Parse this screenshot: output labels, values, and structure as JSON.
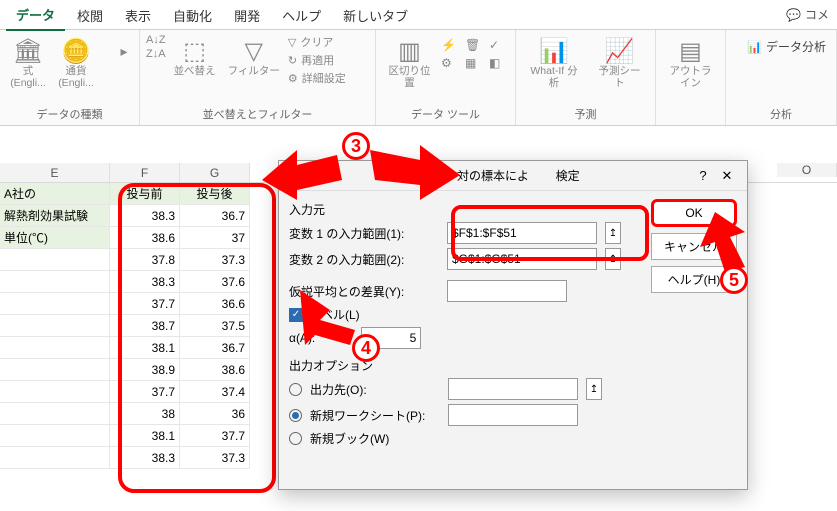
{
  "tabs": {
    "items": [
      "データ",
      "校閲",
      "表示",
      "自動化",
      "開発",
      "ヘルプ",
      "新しいタブ"
    ],
    "active_index": 0,
    "comment": "コメ"
  },
  "ribbon": {
    "groups": [
      {
        "label": "データの種類",
        "buttons": [
          {
            "icon": "🏛",
            "label": "式 (Engli..."
          },
          {
            "icon": "🪙",
            "label": "通貨 (Engli..."
          }
        ]
      },
      {
        "label": "並べ替えとフィルター",
        "buttons_left": [
          {
            "icon": "A↓Z"
          },
          {
            "icon": "Z↓A"
          }
        ],
        "sort_label": "並べ替え",
        "filter_label": "フィルター",
        "mini": [
          "クリア",
          "再適用",
          "詳細設定"
        ]
      },
      {
        "label": "データ ツール",
        "split_label": "区切り位置",
        "mini_icons": [
          "⚡",
          "🗑",
          "✓",
          "⚙",
          "▦",
          "◧"
        ]
      },
      {
        "label": "予測",
        "whatif": "What-If 分析",
        "forecast": "予測シート"
      },
      {
        "label": "",
        "outline": "アウトライン"
      },
      {
        "label": "分析",
        "analysis": "データ分析"
      }
    ]
  },
  "sheet": {
    "col_E": "E",
    "col_F": "F",
    "col_G": "G",
    "col_O": "O",
    "e_rows": [
      "A社の",
      "解熱剤効果試験",
      "単位(℃)"
    ],
    "header_F": "投与前",
    "header_G": "投与後",
    "data": [
      [
        38.3,
        36.7
      ],
      [
        38.6,
        37
      ],
      [
        37.8,
        37.3
      ],
      [
        38.3,
        37.6
      ],
      [
        37.7,
        36.6
      ],
      [
        38.7,
        37.5
      ],
      [
        38.1,
        36.7
      ],
      [
        38.9,
        38.6
      ],
      [
        37.7,
        37.4
      ],
      [
        38,
        36
      ],
      [
        38.1,
        37.7
      ],
      [
        38.3,
        37.3
      ]
    ]
  },
  "dialog": {
    "title_full": "t 検定 : 一対の標本による平均の検定",
    "title_visible_mid": ": 一対の標本によ",
    "title_visible_end": "検定",
    "help_q": "?",
    "close": "✕",
    "section_input": "入力元",
    "var1_label": "変数 1 の入力範囲(1):",
    "var2_label": "変数 2 の入力範囲(2):",
    "var1_value": "$F$1:$F$51",
    "var2_value": "$G$1:$G$51",
    "hypo_label": "仮説平均との差異(Y):",
    "label_chk": "ラベル(L)",
    "alpha_label_pre": "α(A):",
    "alpha_value_suffix": "5",
    "section_output": "出力オプション",
    "out_radio1": "出力先(O):",
    "out_radio2": "新規ワークシート(P):",
    "out_radio3": "新規ブック(W)",
    "btn_ok": "OK",
    "btn_cancel": "キャンセル",
    "btn_help": "ヘルプ(H)"
  },
  "annotations": {
    "n3": "3",
    "n4": "4",
    "n5": "5"
  }
}
